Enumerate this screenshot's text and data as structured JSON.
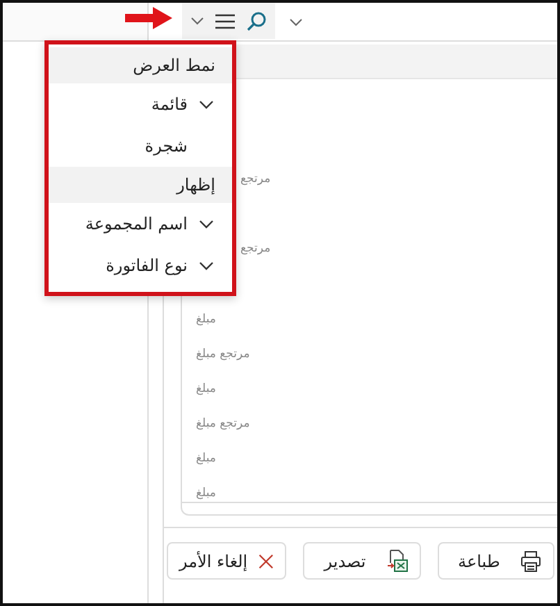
{
  "list": {
    "rows": [
      {
        "kind": "partial",
        "text": "مرتجع"
      },
      {
        "kind": "partial",
        "text": "مرتجع"
      },
      {
        "kind": "full",
        "text": "مبلغ"
      },
      {
        "kind": "full",
        "text": "مرتجع مبلغ"
      },
      {
        "kind": "full",
        "text": "مبلغ"
      },
      {
        "kind": "full",
        "text": "مرتجع مبلغ"
      },
      {
        "kind": "full",
        "text": "مبلغ"
      },
      {
        "kind": "full",
        "text": "مبلغ"
      }
    ]
  },
  "menu": {
    "sections": [
      {
        "title": "نمط العرض",
        "items": [
          {
            "label": "قائمة",
            "kind": "expandable"
          },
          {
            "label": "شجرة",
            "kind": "plain"
          }
        ]
      },
      {
        "title": "إظهار",
        "items": [
          {
            "label": "اسم المجموعة",
            "kind": "expandable"
          },
          {
            "label": "نوع الفاتورة",
            "kind": "expandable"
          }
        ]
      }
    ]
  },
  "buttons": [
    {
      "label": "طباعة"
    },
    {
      "label": "تصدير"
    },
    {
      "label": "إلغاء الأمر"
    }
  ]
}
